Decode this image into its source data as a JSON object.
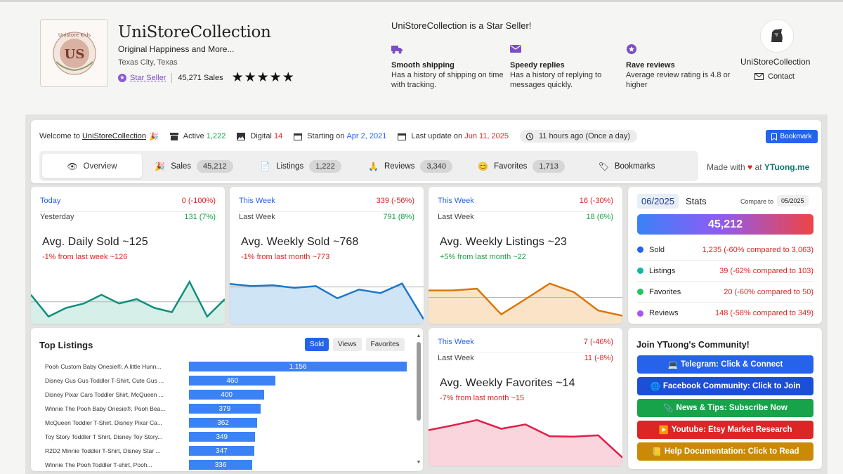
{
  "shop": {
    "name": "UniStoreCollection",
    "tagline": "Original Happiness and More...",
    "location": "Texas City, Texas",
    "star_seller_label": "Star Seller",
    "sales_label": "45,271 Sales",
    "rating_stars": 5,
    "stars_text": "★★★★★",
    "logo_text": "US",
    "logo_ring_text": "Unistore Kids"
  },
  "star_seller": {
    "title": "UniStoreCollection is a Star Seller!",
    "perks": [
      {
        "icon": "truck-icon",
        "title": "Smooth shipping",
        "desc": "Has a history of shipping on time with tracking."
      },
      {
        "icon": "envelope-icon",
        "title": "Speedy replies",
        "desc": "Has a history of replying to messages quickly."
      },
      {
        "icon": "star-badge-icon",
        "title": "Rave reviews",
        "desc": "Average review rating is 4.8 or higher"
      }
    ]
  },
  "owner": {
    "name": "UniStoreCollection",
    "contact_label": "Contact"
  },
  "info_bar": {
    "welcome_prefix": "Welcome to",
    "welcome_shop": "UniStoreCollection",
    "active_label": "Active",
    "active_value": "1,222",
    "digital_label": "Digital",
    "digital_value": "14",
    "starting_label": "Starting on",
    "starting_value": "Apr 2, 2021",
    "update_label": "Last update on",
    "update_value": "Jun 11, 2025",
    "updated_ago": "11 hours ago (Once a day)",
    "bookmark_label": "Bookmark"
  },
  "tabs": [
    {
      "label": "Overview",
      "count": "",
      "icon": "eye-icon"
    },
    {
      "label": "Sales",
      "count": "45,212",
      "icon": "party-icon"
    },
    {
      "label": "Listings",
      "count": "1,222",
      "icon": "document-icon"
    },
    {
      "label": "Reviews",
      "count": "3,340",
      "icon": "clap-icon"
    },
    {
      "label": "Favorites",
      "count": "1,713",
      "icon": "smile-icon"
    },
    {
      "label": "Bookmarks",
      "count": "",
      "icon": "tag-icon"
    }
  ],
  "made_with": {
    "prefix": "Made with",
    "heart": "♥",
    "at": "at",
    "brand": "YTuong.me"
  },
  "stats": [
    {
      "row1_label": "Today",
      "row1_value": "0 (-100%)",
      "row2_label": "Yesterday",
      "row2_value": "131 (7%)",
      "title": "Avg. Daily Sold ~125",
      "sub": "-1% from last week ~126",
      "sub_color": "#dc2626",
      "line_color": "#0f8f7d",
      "fill_color": "#d6efe9",
      "series": [
        6,
        1,
        3,
        4,
        6,
        4,
        5,
        3,
        2,
        9,
        1,
        5
      ],
      "avg": 4.4
    },
    {
      "row1_label": "This Week",
      "row1_value": "339 (-56%)",
      "row2_label": "Last Week",
      "row2_value": "791 (8%)",
      "title": "Avg. Weekly Sold ~768",
      "sub": "-1% from last month ~773",
      "sub_color": "#dc2626",
      "line_color": "#1d78c9",
      "fill_color": "#cfe4f5",
      "series": [
        8.5,
        8,
        8.2,
        7.6,
        8,
        5.2,
        7.2,
        6.4,
        8.6,
        0.4
      ],
      "avg": 7.8
    },
    {
      "row1_label": "This Week",
      "row1_value": "16 (-30%)",
      "row2_label": "Last Week",
      "row2_value": "18 (6%)",
      "title": "Avg. Weekly Listings ~23",
      "sub": "+5% from last month ~22",
      "sub_color": "#16a34a",
      "line_color": "#d97706",
      "fill_color": "#fbe3c8",
      "series": [
        7,
        7,
        7.4,
        1.5,
        5,
        8.6,
        6.6,
        2.4,
        1.2
      ],
      "avg": 5.4
    }
  ],
  "month_stats": {
    "month": "06/2025",
    "label": "Stats",
    "compare_label": "Compare to",
    "compare_value": "05/2025",
    "total": "45,212",
    "rows": [
      {
        "name": "Sold",
        "value": "1,235 (-60% compared to 3,063)",
        "color": "#2563eb"
      },
      {
        "name": "Listings",
        "value": "39 (-62% compared to 103)",
        "color": "#14b8a6"
      },
      {
        "name": "Favorites",
        "value": "20 (-60% compared to 50)",
        "color": "#22c55e"
      },
      {
        "name": "Reviews",
        "value": "148 (-58% compared to 349)",
        "color": "#a855f7"
      }
    ]
  },
  "top_listings": {
    "title": "Top Listings",
    "sort_buttons": [
      "Sold",
      "Views",
      "Favorites"
    ],
    "max": 1156,
    "items": [
      {
        "name": "Pooh Custom Baby Onesie®, A little Hunn...",
        "value": 1156,
        "label": "1,156"
      },
      {
        "name": "Disney Gus Gus Toddler T-Shirt, Cute Gus ...",
        "value": 460,
        "label": "460"
      },
      {
        "name": "Disney Pixar Cars Toddler Shirt, McQueen ...",
        "value": 400,
        "label": "400"
      },
      {
        "name": "Winnie The Pooh Baby Onesie®, Pooh Bea...",
        "value": 379,
        "label": "379"
      },
      {
        "name": "McQueen Toddler T-Shirt, Disney Pixar Ca...",
        "value": 362,
        "label": "362"
      },
      {
        "name": "Toy Story Toddler T Shirt, Disney Toy Story...",
        "value": 349,
        "label": "349"
      },
      {
        "name": "R2D2 Minnie Toddler T-Shirt, Disney Star ...",
        "value": 347,
        "label": "347"
      },
      {
        "name": "Winnie The Pooh Toddler T-shirt, Pooh...",
        "value": 336,
        "label": "336"
      }
    ]
  },
  "favorites_stat": {
    "row1_label": "This Week",
    "row1_value": "7 (-46%)",
    "row2_label": "Last Week",
    "row2_value": "11 (-8%)",
    "title": "Avg. Weekly Favorites ~14",
    "sub": "-7% from last month ~15",
    "sub_color": "#dc2626",
    "line_color": "#e11d48",
    "fill_color": "#fbd5dd",
    "series": [
      7.5,
      8.6,
      9.8,
      7.8,
      8.8,
      6.1,
      6.0,
      6.3,
      1.2
    ],
    "avg": 0
  },
  "community": {
    "title": "Join YTuong's Community!",
    "buttons": [
      {
        "icon": "💻",
        "label": "Telegram: Click & Connect",
        "color": "#2563eb"
      },
      {
        "icon": "🌐",
        "label": "Facebook Community: Click to Join",
        "color": "#1d4ed8"
      },
      {
        "icon": "📎",
        "label": "News & Tips: Subscribe Now",
        "color": "#16a34a"
      },
      {
        "icon": "▶️",
        "label": "Youtube: Etsy Market Research",
        "color": "#dc2626"
      },
      {
        "icon": "📒",
        "label": "Help Documentation: Click to Read",
        "color": "#ca8a04"
      }
    ]
  }
}
